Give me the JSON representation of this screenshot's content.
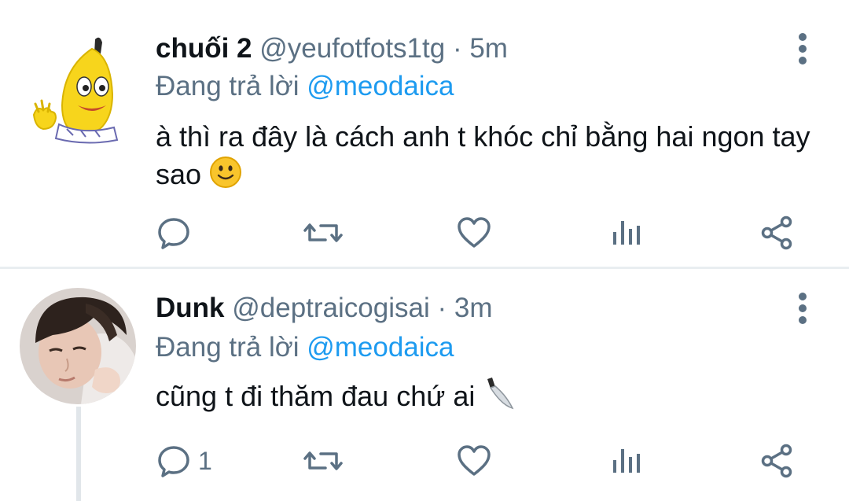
{
  "tweets": [
    {
      "name": "chuối 2",
      "handle": "@yeufotfots1tg",
      "separator": "·",
      "time": "5m",
      "reply_prefix": "Đang trả lời",
      "reply_mention": "@meodaica",
      "text": "à thì ra đây là cách anh t khóc chỉ bằng hai ngon tay sao",
      "emoji": "slightly-smiling-face",
      "reply_count": "",
      "avatar": "banana-character"
    },
    {
      "name": "Dunk",
      "handle": "@deptraicogisai",
      "separator": "·",
      "time": "3m",
      "reply_prefix": "Đang trả lời",
      "reply_mention": "@meodaica",
      "text": "cũng t đi thăm đau chứ ai",
      "emoji": "kitchen-knife",
      "reply_count": "1",
      "avatar": "person-photo"
    }
  ],
  "colors": {
    "text": "#0f1419",
    "secondary": "#5b7083",
    "mention": "#1d9bf0",
    "divider": "#e9eef1",
    "thread_line": "#e1e6ea"
  }
}
